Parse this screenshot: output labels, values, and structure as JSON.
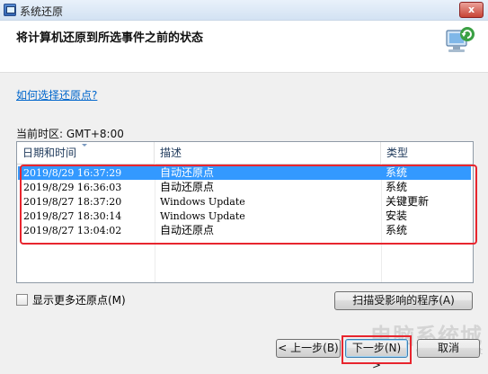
{
  "window": {
    "title": "系统还原",
    "close_label": "x"
  },
  "header": {
    "title": "将计算机还原到所选事件之前的状态"
  },
  "help_link": "如何选择还原点?",
  "timezone_label": "当前时区: GMT+8:00",
  "table": {
    "columns": [
      "日期和时间",
      "描述",
      "类型"
    ],
    "rows": [
      {
        "datetime": "2019/8/29 16:37:29",
        "description": "自动还原点",
        "type": "系统",
        "selected": true
      },
      {
        "datetime": "2019/8/29 16:36:03",
        "description": "自动还原点",
        "type": "系统",
        "selected": false
      },
      {
        "datetime": "2019/8/27 18:37:20",
        "description": "Windows Update",
        "type": "关键更新",
        "selected": false
      },
      {
        "datetime": "2019/8/27 18:30:14",
        "description": "Windows Update",
        "type": "安装",
        "selected": false
      },
      {
        "datetime": "2019/8/27 13:04:02",
        "description": "自动还原点",
        "type": "系统",
        "selected": false
      }
    ]
  },
  "show_more_label": "显示更多还原点(M)",
  "buttons": {
    "scan": "扫描受影响的程序(A)",
    "back": "< 上一步(B)",
    "next": "下一步(N) >",
    "cancel": "取消"
  },
  "watermark": {
    "main": "电脑系统城",
    "sub": "www.dnxtc.net"
  },
  "colors": {
    "selection": "#3399ff",
    "highlight_box": "#e8252e",
    "link": "#0066cc"
  }
}
